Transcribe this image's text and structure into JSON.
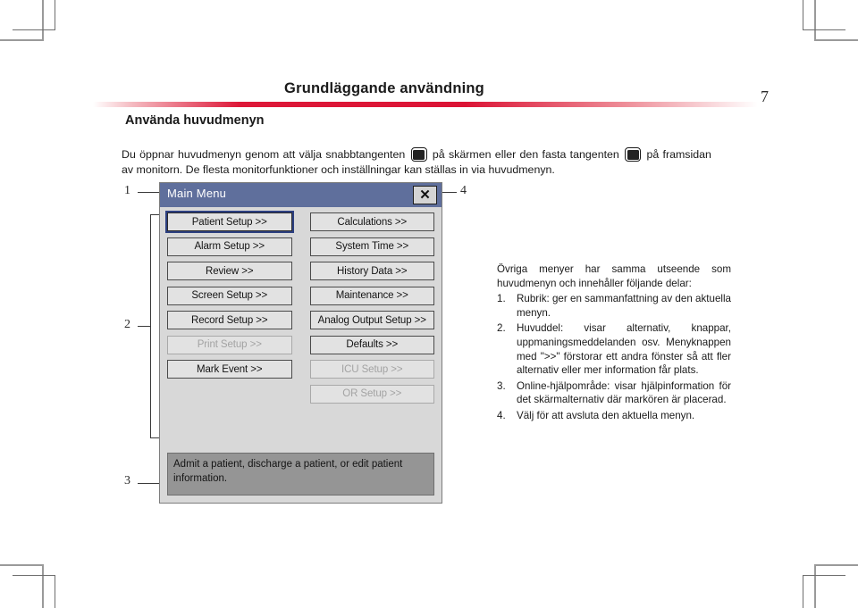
{
  "page": {
    "chapter_title": "Grundläggande användning",
    "page_number": "7",
    "section_title": "Använda huvudmenyn",
    "accent_color": "#dd1838",
    "intro_parts": {
      "p1": "Du öppnar huvudmenyn genom att välja snabbtangenten",
      "p2": "på skärmen eller den fasta tangenten",
      "p3": "på framsidan av monitorn. De flesta monitorfunktioner och inställningar kan ställas in via huvudmenyn."
    }
  },
  "dialog": {
    "title": "Main Menu",
    "close_label": "✕",
    "titlebar_color": "#5f6f9c",
    "body_color": "#d8d8d8",
    "help_color": "#959595",
    "rows": [
      [
        {
          "label": "Patient Setup >>",
          "state": "selected"
        },
        {
          "label": "Calculations >>",
          "state": "normal"
        }
      ],
      [
        {
          "label": "Alarm Setup >>",
          "state": "normal"
        },
        {
          "label": "System Time >>",
          "state": "normal"
        }
      ],
      [
        {
          "label": "Review >>",
          "state": "normal"
        },
        {
          "label": "History Data >>",
          "state": "normal"
        }
      ],
      [
        {
          "label": "Screen Setup >>",
          "state": "normal"
        },
        {
          "label": "Maintenance >>",
          "state": "normal"
        }
      ],
      [
        {
          "label": "Record Setup >>",
          "state": "normal"
        },
        {
          "label": "Analog Output Setup >>",
          "state": "normal"
        }
      ],
      [
        {
          "label": "Print Setup >>",
          "state": "disabled"
        },
        {
          "label": "Defaults >>",
          "state": "normal"
        }
      ],
      [
        {
          "label": "Mark Event >>",
          "state": "normal"
        },
        {
          "label": "ICU Setup >>",
          "state": "disabled"
        }
      ],
      [
        {
          "label": "",
          "state": "empty"
        },
        {
          "label": "OR Setup >>",
          "state": "disabled"
        }
      ]
    ],
    "help_text": "Admit a patient, discharge a patient, or edit patient information."
  },
  "callouts": {
    "one": "1",
    "two": "2",
    "three": "3",
    "four": "4"
  },
  "explanation": {
    "lead": "Övriga menyer har samma utseende som huvudmenyn och innehåller följande delar:",
    "items": [
      {
        "num": "1.",
        "text": "Rubrik: ger en sammanfattning av den aktuella menyn."
      },
      {
        "num": "2.",
        "text": "Huvuddel: visar alternativ, knappar, uppmaningsmeddelanden osv. Menyknappen med \">>\" förstorar ett andra fönster så att fler alternativ eller mer information får plats."
      },
      {
        "num": "3.",
        "text": "Online-hjälpområde: visar hjälpinformation för det skärmalternativ där markören är placerad."
      },
      {
        "num": "4.",
        "text": "Välj för att avsluta den aktuella menyn."
      }
    ]
  }
}
